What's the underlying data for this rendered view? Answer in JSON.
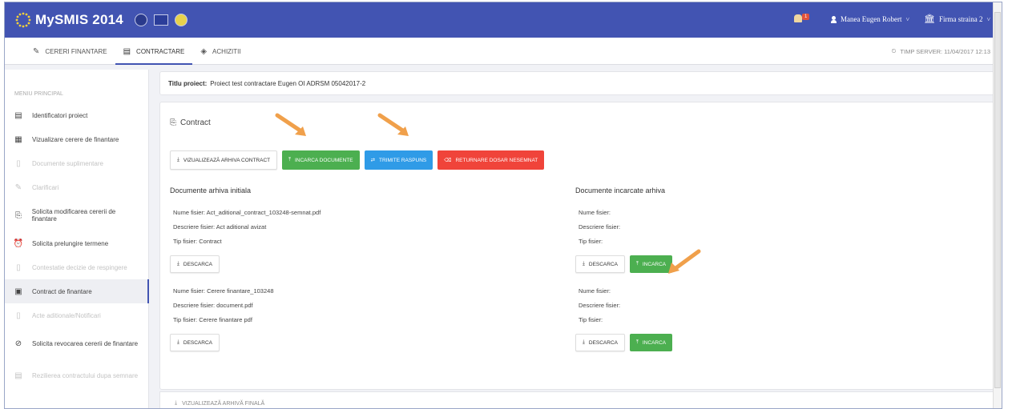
{
  "app": {
    "title": "MySMIS 2014"
  },
  "topbar": {
    "notification_count": "1",
    "user_name": "Manea Eugen Robert",
    "firm_name": "Firma straina 2"
  },
  "nav": {
    "tabs": [
      {
        "label": "CERERI FINANTARE",
        "icon": "pencil-icon"
      },
      {
        "label": "CONTRACTARE",
        "icon": "document-icon"
      },
      {
        "label": "ACHIZITII",
        "icon": "layers-icon"
      }
    ],
    "server_time": "TIMP SERVER: 11/04/2017 12:13"
  },
  "sidebar": {
    "heading": "MENIU PRINCIPAL",
    "items": [
      {
        "label": "Identificatori proiect",
        "state": "enabled"
      },
      {
        "label": "Vizualizare cerere de finantare",
        "state": "enabled"
      },
      {
        "label": "Documente suplimentare",
        "state": "disabled"
      },
      {
        "label": "Clarificari",
        "state": "disabled"
      },
      {
        "label": "Solicita modificarea cererii de finantare",
        "state": "enabled"
      },
      {
        "label": "Solicita prelungire termene",
        "state": "enabled"
      },
      {
        "label": "Contestatie decizie de respingere",
        "state": "disabled"
      },
      {
        "label": "Contract de finantare",
        "state": "active"
      },
      {
        "label": "Acte aditionale/Notificari",
        "state": "disabled"
      },
      {
        "label": "Solicita revocarea cererii de finantare",
        "state": "enabled"
      },
      {
        "label": "Rezilierea contractului dupa semnare",
        "state": "disabled"
      }
    ]
  },
  "project": {
    "label": "Titlu proiect:",
    "value": "Proiect test contractare Eugen OI ADRSM 05042017-2"
  },
  "contract": {
    "heading": "Contract",
    "buttons": {
      "view_archive": "VIZUALIZEAZĂ ARHIVA CONTRACT",
      "upload_docs": "INCARCA DOCUMENTE",
      "send_response": "TRIMITE RASPUNS",
      "return_unsigned": "RETURNARE DOSAR NESEMNAT"
    },
    "initial": {
      "heading": "Documente arhiva initiala",
      "docs": [
        {
          "name": "Nume fisier: Act_aditional_contract_103248-semnat.pdf",
          "desc": "Descriere fisier: Act aditional avizat",
          "type": "Tip fisier: Contract"
        },
        {
          "name": "Nume fisier: Cerere finantare_103248",
          "desc": "Descriere fisier: document.pdf",
          "type": "Tip fisier: Cerere finantare pdf"
        }
      ]
    },
    "uploaded": {
      "heading": "Documente incarcate arhiva",
      "docs": [
        {
          "name": "Nume fisier:",
          "desc": "Descriere fisier:",
          "type": "Tip fisier:"
        },
        {
          "name": "Nume fisier:",
          "desc": "Descriere fisier:",
          "type": "Tip fisier:"
        }
      ]
    },
    "download_label": "DESCARCA",
    "upload_label": "INCARCA",
    "final_archive": "VIZUALIZEAZĂ ARHIVĂ FINALĂ"
  },
  "colors": {
    "header": "#4254b2",
    "green": "#4caf50",
    "blue": "#2f9be7",
    "red": "#f0443a",
    "arrow": "#f0a04b"
  }
}
